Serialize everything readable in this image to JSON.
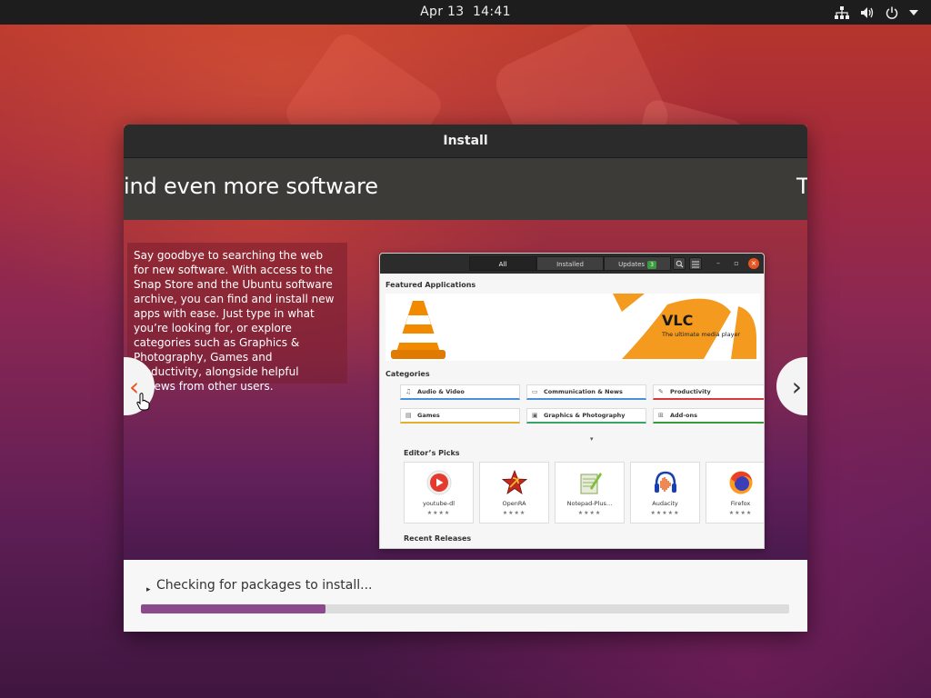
{
  "topbar": {
    "date": "Apr 13",
    "time": "14:41",
    "icons": [
      "network-icon",
      "volume-icon",
      "power-icon",
      "menu-arrow-icon"
    ]
  },
  "window": {
    "title": "Install",
    "slide_title": "ind even more software",
    "slide_title_next": "T",
    "description": "Say goodbye to searching the web for new software. With access to the Snap Store and the Ubuntu software archive, you can find and install new apps with ease. Just type in what you’re looking for, or explore categories such as Graphics & Photography, Games and Productivity, alongside helpful reviews from other users.",
    "nav_prev": "‹",
    "nav_next": "›"
  },
  "store": {
    "tabs": [
      {
        "label": "All"
      },
      {
        "label": "Installed"
      },
      {
        "label": "Updates",
        "badge": "3"
      }
    ],
    "featured_label": "Featured Applications",
    "featured_app": {
      "name": "VLC",
      "tagline": "The ultimate media player"
    },
    "categories_label": "Categories",
    "categories": [
      {
        "label": "Audio & Video",
        "color": "#4a90d9"
      },
      {
        "label": "Communication & News",
        "color": "#4a90d9"
      },
      {
        "label": "Productivity",
        "color": "#d63a3a"
      },
      {
        "label": "Games",
        "color": "#e0b030"
      },
      {
        "label": "Graphics & Photography",
        "color": "#3aa36a"
      },
      {
        "label": "Add-ons",
        "color": "#3a9a3a"
      }
    ],
    "editors_picks_label": "Editor’s Picks",
    "picks": [
      {
        "name": "youtube-dl",
        "stars": "★★★★"
      },
      {
        "name": "OpenRA",
        "stars": "★★★★"
      },
      {
        "name": "Notepad-Plus…",
        "stars": "★★★★"
      },
      {
        "name": "Audacity",
        "stars": "★★★★★"
      },
      {
        "name": "Firefox",
        "stars": "★★★★"
      }
    ],
    "recent_label": "Recent Releases"
  },
  "footer": {
    "status": "Checking for packages to install...",
    "progress": 0.285
  },
  "colors": {
    "accent": "#e95420",
    "progress": "#8a4a8c"
  }
}
